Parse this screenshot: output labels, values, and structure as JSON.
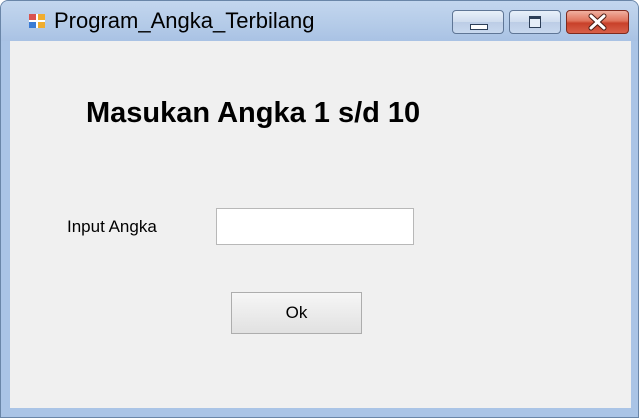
{
  "window": {
    "title": "Program_Angka_Terbilang",
    "icon": "windows-form-icon"
  },
  "caption_buttons": {
    "minimize_icon": "minimize-icon",
    "maximize_icon": "maximize-icon",
    "close_icon": "close-icon",
    "close_color": "#c8412a"
  },
  "form": {
    "heading": "Masukan Angka 1 s/d 10",
    "input_label": "Input Angka",
    "input_value": "",
    "ok_label": "Ok",
    "background": "#f0f0f0"
  }
}
